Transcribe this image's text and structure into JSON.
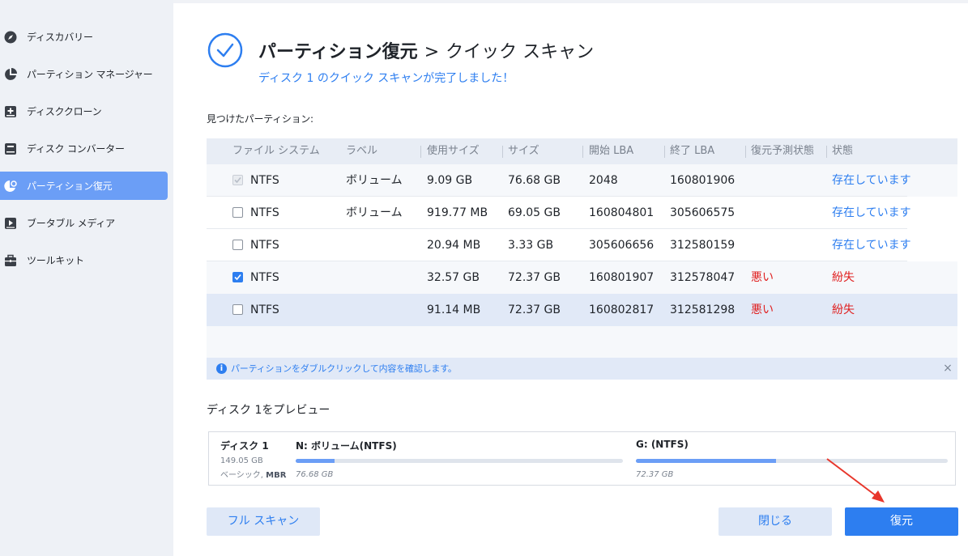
{
  "sidebar": {
    "items": [
      {
        "label": "ディスカバリー",
        "icon": "compass-icon",
        "active": false
      },
      {
        "label": "パーティション マネージャー",
        "icon": "pie-chart-icon",
        "active": false
      },
      {
        "label": "ディスククローン",
        "icon": "disk-plus-icon",
        "active": false
      },
      {
        "label": "ディスク コンバーター",
        "icon": "disk-icon",
        "active": false
      },
      {
        "label": "パーティション復元",
        "icon": "partition-recovery-icon",
        "active": true
      },
      {
        "label": "ブータブル メディア",
        "icon": "bootable-media-icon",
        "active": false
      },
      {
        "label": "ツールキット",
        "icon": "toolbox-icon",
        "active": false
      }
    ]
  },
  "header": {
    "title_main": "パーティション復元",
    "title_sep": ">",
    "title_sub": "クイック スキャン",
    "subtitle": "ディスク 1 のクイック スキャンが完了しました！"
  },
  "found_label": "見つけたパーティション:",
  "table": {
    "columns": [
      "ファイル システム",
      "ラベル",
      "使用サイズ",
      "サイズ",
      "開始 LBA",
      "終了 LBA",
      "復元予測状態",
      "状態"
    ],
    "rows": [
      {
        "checked": true,
        "disabled": true,
        "fs": "NTFS",
        "label": "ボリューム",
        "used": "9.09 GB",
        "size": "76.68 GB",
        "start": "2048",
        "end": "160801906",
        "prediction": "",
        "status": "存在しています",
        "status_color": "#2d7ef0"
      },
      {
        "checked": false,
        "disabled": false,
        "fs": "NTFS",
        "label": "ボリューム",
        "used": "919.77 MB",
        "size": "69.05 GB",
        "start": "160804801",
        "end": "305606575",
        "prediction": "",
        "status": "存在しています",
        "status_color": "#2d7ef0"
      },
      {
        "checked": false,
        "disabled": false,
        "fs": "NTFS",
        "label": "",
        "used": "20.94 MB",
        "size": "3.33 GB",
        "start": "305606656",
        "end": "312580159",
        "prediction": "",
        "status": "存在しています",
        "status_color": "#2d7ef0"
      },
      {
        "checked": true,
        "disabled": false,
        "fs": "NTFS",
        "label": "",
        "used": "32.57 GB",
        "size": "72.37 GB",
        "start": "160801907",
        "end": "312578047",
        "prediction": "悪い",
        "status": "紛失",
        "status_color": "#e02020"
      },
      {
        "checked": false,
        "disabled": false,
        "fs": "NTFS",
        "label": "",
        "used": "91.14 MB",
        "size": "72.37 GB",
        "start": "160802817",
        "end": "312581298",
        "prediction": "悪い",
        "status": "紛失",
        "status_color": "#e02020"
      }
    ]
  },
  "info_bar": {
    "text": "パーティションをダブルクリックして内容を確認します。",
    "icon": "info-icon",
    "close_glyph": "×"
  },
  "preview": {
    "title": "ディスク 1をプレビュー",
    "disk_name": "ディスク 1",
    "disk_size": "149.05 GB",
    "disk_type_prefix": "ベーシック, ",
    "disk_type_bold": "MBR",
    "partitions": [
      {
        "name": "N: ボリューム(NTFS)",
        "size": "76.68 GB",
        "fill_fraction": 0.12
      },
      {
        "name": "G: (NTFS)",
        "size": "72.37 GB",
        "fill_fraction": 0.45
      }
    ]
  },
  "buttons": {
    "full_scan": "フル スキャン",
    "close": "閉じる",
    "recover": "復元"
  },
  "colors": {
    "accent": "#2d7ef0",
    "sidebar_active": "#6b9ef6",
    "danger": "#e02020",
    "annotation_arrow": "#e8362b"
  }
}
